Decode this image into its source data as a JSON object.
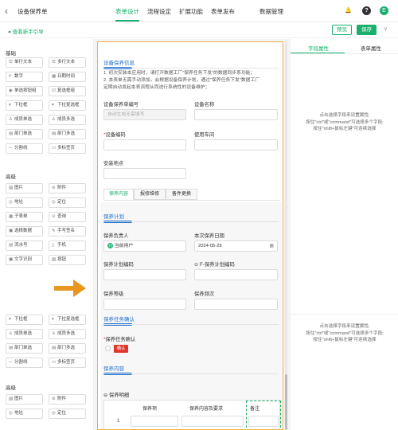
{
  "header": {
    "title": "设备保养单",
    "tabs": [
      "表单设计",
      "流程设定",
      "扩展功能",
      "表单发布",
      "数据管理"
    ],
    "active_tab": "表单设计",
    "user_initial": "E"
  },
  "toolbar": {
    "guide": "查看新手引导",
    "preview": "预览",
    "save": "保存"
  },
  "palette": {
    "basic_title": "基础",
    "basic_items": [
      {
        "icon": "☰",
        "label": "单行文本"
      },
      {
        "icon": "☰",
        "label": "多行文本"
      },
      {
        "icon": "#",
        "label": "数字"
      },
      {
        "icon": "▦",
        "label": "日期时间"
      },
      {
        "icon": "◉",
        "label": "单选按钮组"
      },
      {
        "icon": "☑",
        "label": "复选框组"
      },
      {
        "icon": "▾",
        "label": "下拉框"
      },
      {
        "icon": "▾",
        "label": "下拉复选框"
      },
      {
        "icon": "♙",
        "label": "成员单选"
      },
      {
        "icon": "♙",
        "label": "成员多选"
      },
      {
        "icon": "▤",
        "label": "部门单选"
      },
      {
        "icon": "▤",
        "label": "部门多选"
      },
      {
        "icon": "─",
        "label": "分割线"
      },
      {
        "icon": "▭",
        "label": "多标签页"
      }
    ],
    "advanced_title": "高级",
    "advanced_items": [
      {
        "icon": "▨",
        "label": "图片"
      },
      {
        "icon": "⊘",
        "label": "附件"
      },
      {
        "icon": "◎",
        "label": "地址"
      },
      {
        "icon": "◎",
        "label": "定位"
      },
      {
        "icon": "▦",
        "label": "子表单"
      },
      {
        "icon": "⊙",
        "label": "查询"
      },
      {
        "icon": "▣",
        "label": "选择数据"
      },
      {
        "icon": "✎",
        "label": "手写签名"
      },
      {
        "icon": "▤",
        "label": "流水号"
      },
      {
        "icon": "▯",
        "label": "手机"
      },
      {
        "icon": "▣",
        "label": "文字识别"
      },
      {
        "icon": "▧",
        "label": "按钮"
      }
    ],
    "basic_items_2": [
      {
        "icon": "▾",
        "label": "下拉框"
      },
      {
        "icon": "▾",
        "label": "下拉复选框"
      },
      {
        "icon": "♙",
        "label": "成员单选"
      },
      {
        "icon": "♙",
        "label": "成员多选"
      },
      {
        "icon": "▤",
        "label": "部门单选"
      },
      {
        "icon": "▤",
        "label": "部门多选"
      },
      {
        "icon": "─",
        "label": "分割线"
      },
      {
        "icon": "▭",
        "label": "多标签页"
      }
    ],
    "advanced_title_2": "高级",
    "advanced_items_2": [
      {
        "icon": "▨",
        "label": "图片"
      },
      {
        "icon": "⊘",
        "label": "附件"
      },
      {
        "icon": "◎",
        "label": "地址"
      },
      {
        "icon": "◎",
        "label": "定位"
      }
    ]
  },
  "form": {
    "info_title": "设备保养信息",
    "note_line1": "1. 初次安装本应用时，请打开数据工厂\"保养任务下发\"的数据同步系功能；",
    "note_line2": "2. 本表单无需手动添加，会根据设备保养计划，通过\"保养任务下发\"数据工厂",
    "note_line3": "定期自动发起本表流程从而进行系统性的设备维护；",
    "field_code": "设备保养单编号",
    "field_code_placeholder": "自动生成无需填写",
    "field_name": "设备名称",
    "field_device_code": "设备编码",
    "field_workshop": "使用车间",
    "field_location": "安装地点",
    "tabs": [
      "保养内容",
      "报修维修",
      "备件更换"
    ],
    "plan_title": "保养计划",
    "owner_label": "保养负责人",
    "owner_value": "当前用户",
    "owner_initial": "刘",
    "date_label": "本次保养日期",
    "date_value": "2024-05-29",
    "plan_code_label": "保养计划编码",
    "fplan_label": "F-保养计划编码",
    "level_label": "保养等级",
    "times_label": "保养频次",
    "task_title": "保养任务确认",
    "confirm_label": "保养任务确认",
    "confirm_option": "确认",
    "content_title": "保养内容",
    "detail_label": "保养明细",
    "table_headers": [
      "保养项",
      "保养内容及要求",
      "备注"
    ],
    "row_number": "1"
  },
  "right_panel": {
    "tab_field": "字段属性",
    "tab_form": "表单属性",
    "hint_line1": "点击选择字段来设置属性;",
    "hint_line2": "按住\"ctrl\"或\"command\"可选择多个字段;",
    "hint_line3": "按住\"shift+鼠标左键\"可连续选择"
  },
  "colors": {
    "accent": "#1aaf6c",
    "section_blue": "#1f6fd0",
    "required": "#e0352b",
    "arrow": "#e8961e",
    "selected_border": "#f0b04a"
  }
}
